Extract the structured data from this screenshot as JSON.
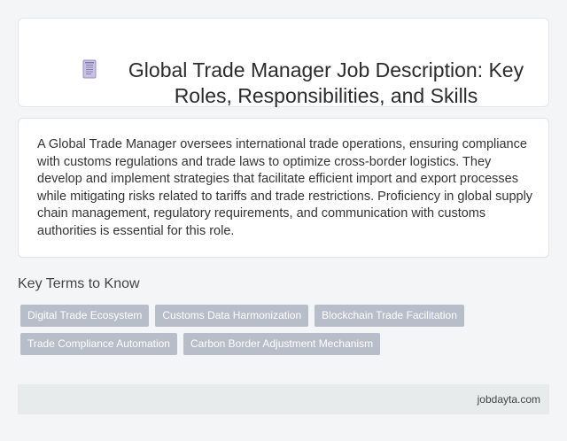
{
  "header": {
    "icon": "document-icon",
    "title_line1": "Global Trade Manager Job Description: Key",
    "title_line2": "Roles, Responsibilities, and Skills"
  },
  "summary": {
    "text": "A Global Trade Manager oversees international trade operations, ensuring compliance with customs regulations and trade laws to optimize cross-border logistics. They develop and implement strategies that facilitate efficient import and export processes while mitigating risks related to tariffs and trade restrictions. Proficiency in global supply chain management, regulatory requirements, and communication with customs authorities is essential for this role."
  },
  "key_terms": {
    "heading": "Key Terms to Know",
    "row1": [
      "Digital Trade Ecosystem",
      "Customs Data Harmonization",
      "Blockchain Trade Facilitation"
    ],
    "row2": [
      "Trade Compliance Automation",
      "Carbon Border Adjustment Mechanism"
    ]
  },
  "footer": {
    "site": "jobdayta.com"
  },
  "colors": {
    "chip_bg": "#b7bdc9",
    "footer_bg": "#e7ebec",
    "icon_accent": "#9b8fc4"
  }
}
